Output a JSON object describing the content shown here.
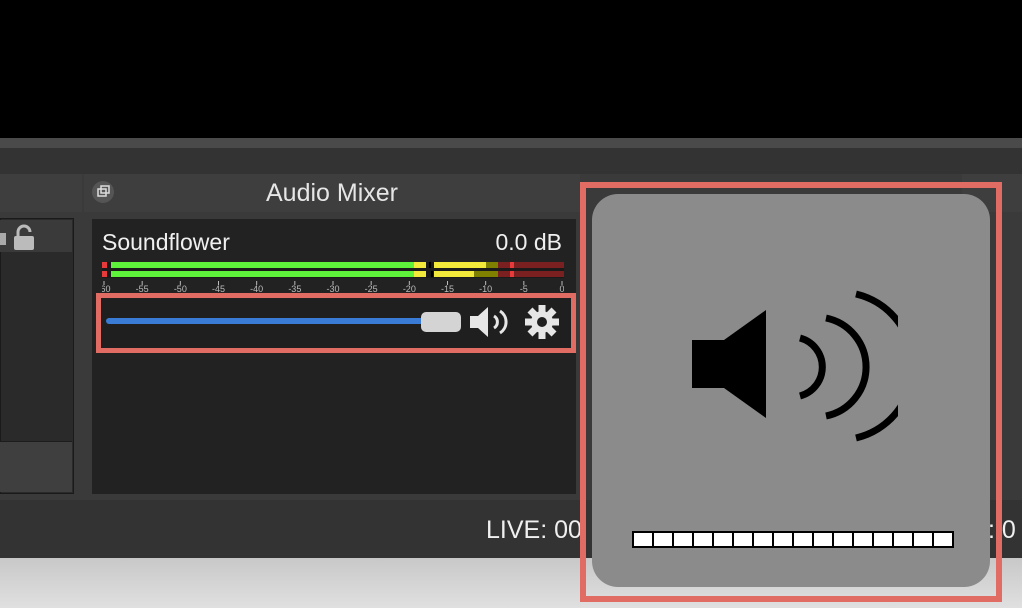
{
  "mixer": {
    "title": "Audio Mixer",
    "source_name": "Soundflower",
    "volume_db": "0.0 dB",
    "fader_level": 1.0,
    "meter_ticks": [
      "-60",
      "-55",
      "-50",
      "-45",
      "-40",
      "-35",
      "-30",
      "-25",
      "-20",
      "-15",
      "-10",
      "-5",
      "0"
    ]
  },
  "status": {
    "live_text": "LIVE: 00",
    "right_text": ": 0"
  },
  "hud": {
    "segments_total": 16,
    "segments_filled": 16
  },
  "colors": {
    "highlight": "#e06c63",
    "fader": "#3a7bd5",
    "meter_green": "#5ef23a",
    "meter_yellow": "#f2e93a",
    "meter_red": "#e83a3a"
  },
  "icons": {
    "speaker": "speaker-volume-icon",
    "settings": "gear-icon",
    "lock": "lock-icon",
    "undock": "undock-icon"
  }
}
